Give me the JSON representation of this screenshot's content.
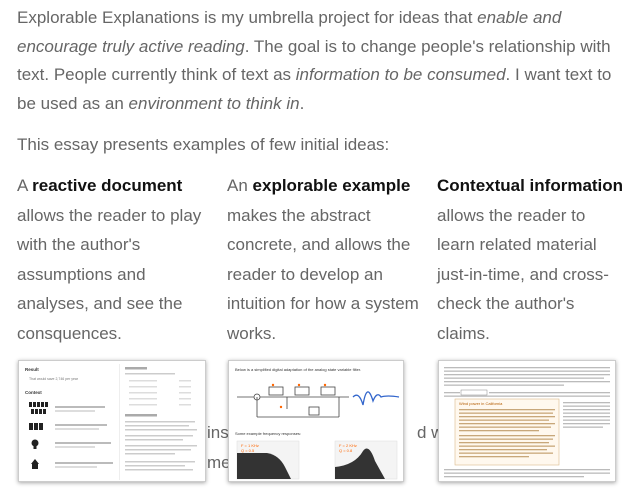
{
  "intro": {
    "p1": "Explorable Explanations is my umbrella project for ideas that ",
    "em1": "enable and encourage truly active reading",
    "p2": ". The goal is to change people's relationship with text. People currently think of text as ",
    "em2": "information to be consumed",
    "p3": ". I want text to be used as an ",
    "em3": "environment to think in",
    "p4": "."
  },
  "lead": "This essay presents examples of few initial ideas:",
  "columns": [
    {
      "pre": "A ",
      "bold": "reactive document",
      "post": " allows the reader to play with the author's assumptions and analyses, and see the consquences."
    },
    {
      "pre": "An ",
      "bold": "explorable example",
      "post": " makes the abstract concrete, and allows the reader to develop an intuition for how a system works."
    },
    {
      "pre": "",
      "bold": "Contextual information",
      "post": " allows the reader to learn related material just-in-time, and cross-check the author's claims."
    }
  ],
  "partial_text": {
    "a": "ins",
    "b": "d w",
    "c": "me"
  },
  "thumbnails": {
    "t1": {
      "title": "Result",
      "subtitle": "That would save 2,746 per year",
      "section": "Context"
    },
    "t2": {
      "title": "Below is a simplified digital adaptation of the analog state variable filter.",
      "sub": "Some example frequency responses:",
      "labels": [
        "F = 1 KHz",
        "F = 2 KHz"
      ],
      "qvals": [
        "Q = 0.5",
        "Q = 0.8"
      ]
    },
    "t3": {
      "popup_title": "Wind power in California"
    }
  },
  "colors": {
    "text": "#666666",
    "bold": "#111111",
    "accent": "#ff6600",
    "wave": "#3366cc"
  }
}
